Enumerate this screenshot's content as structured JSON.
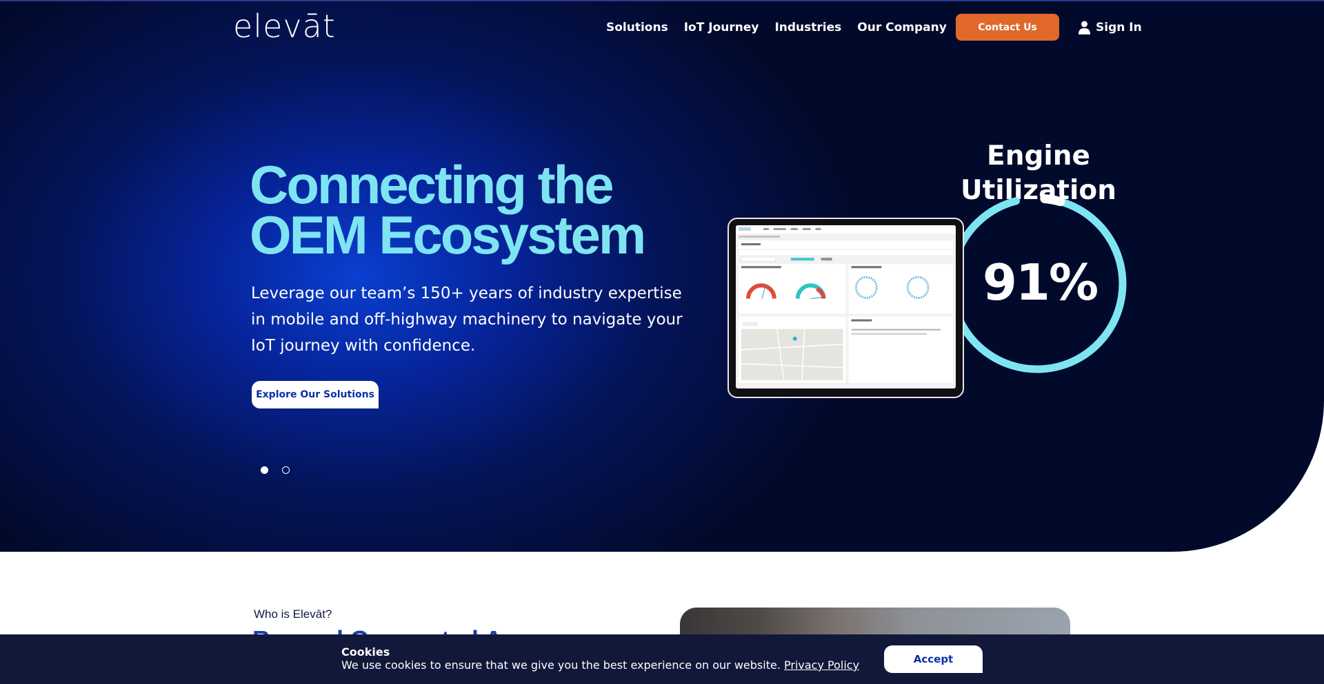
{
  "brand": {
    "logo_text": "elevāt"
  },
  "nav": {
    "items": [
      {
        "label": "Solutions"
      },
      {
        "label": "IoT Journey"
      },
      {
        "label": "Industries"
      },
      {
        "label": "Our Company"
      }
    ],
    "contact_label": "Contact Us",
    "signin_label": "Sign In"
  },
  "hero": {
    "headline_line1": "Connecting the",
    "headline_line2": "OEM Ecosystem",
    "subtext": "Leverage our team’s 150+ years of industry expertise in mobile and off-highway machinery to navigate your IoT journey with confidence.",
    "cta_label": "Explore Our Solutions",
    "slides": {
      "count": 2,
      "active_index": 0
    }
  },
  "metric": {
    "title": "Engine Utilization",
    "value_text": "91%",
    "value_fraction": 0.91
  },
  "about": {
    "label": "Who is Elevāt?",
    "heading_partial": "Beyond Connected A"
  },
  "cookie": {
    "title": "Cookies",
    "text": "We use cookies to ensure that we give you the best experience on our website.",
    "link_label": "Privacy Policy",
    "accept_label": "Accept"
  },
  "colors": {
    "accent_orange": "#e0692a",
    "headline_cyan": "#7fe4f2",
    "ring_cyan": "#7fe4f2",
    "navy": "#11183a",
    "brand_blue": "#1b3fa8"
  },
  "icons": {
    "signin": "user-icon"
  }
}
